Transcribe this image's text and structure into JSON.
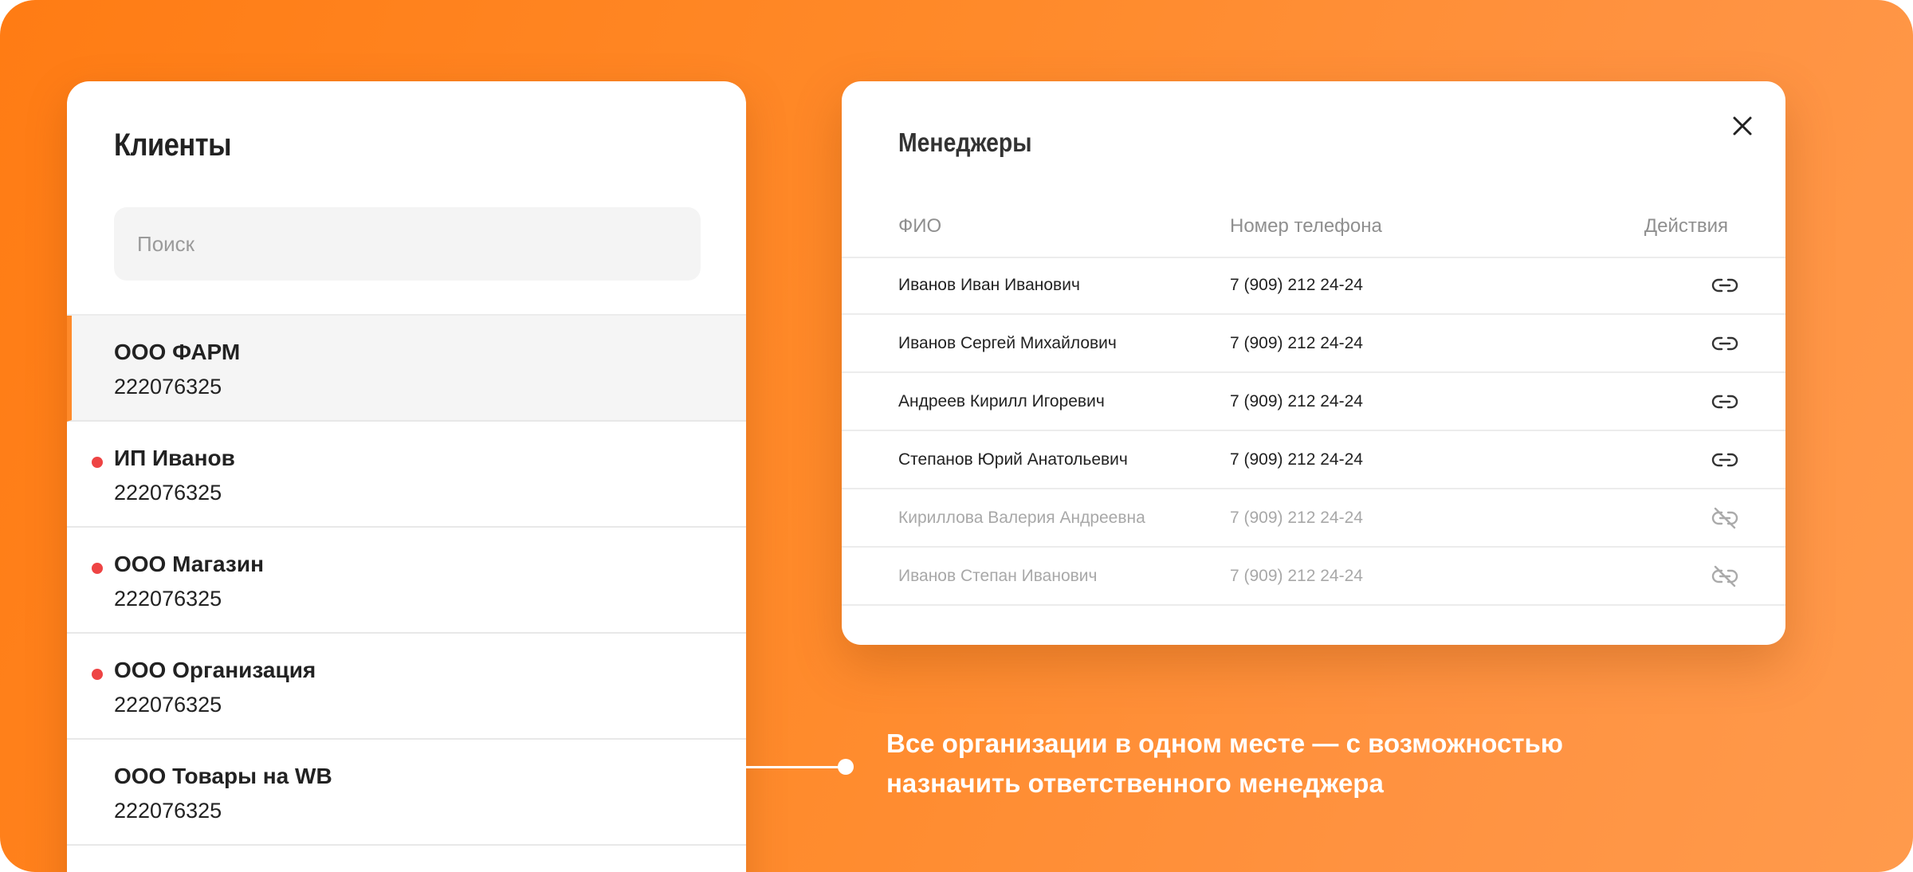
{
  "clients": {
    "title": "Клиенты",
    "search_placeholder": "Поиск",
    "items": [
      {
        "name": "ООО ФАРМ",
        "inn": "222076325",
        "active": true,
        "unread": false
      },
      {
        "name": "ИП Иванов",
        "inn": "222076325",
        "active": false,
        "unread": true
      },
      {
        "name": "ООО Магазин",
        "inn": "222076325",
        "active": false,
        "unread": true
      },
      {
        "name": "ООО Организация",
        "inn": "222076325",
        "active": false,
        "unread": true
      },
      {
        "name": "ООО Товары на WB",
        "inn": "222076325",
        "active": false,
        "unread": false
      }
    ]
  },
  "managers": {
    "title": "Менеджеры",
    "columns": {
      "fio": "ФИО",
      "phone": "Номер телефона",
      "actions": "Действия"
    },
    "rows": [
      {
        "fio": "Иванов Иван Иванович",
        "phone": "7 (909) 212 24-24",
        "action_icon": "link-icon",
        "enabled": true
      },
      {
        "fio": "Иванов Сергей Михайлович",
        "phone": "7 (909) 212 24-24",
        "action_icon": "link-icon",
        "enabled": true
      },
      {
        "fio": "Андреев Кирилл Игоревич",
        "phone": "7 (909) 212 24-24",
        "action_icon": "link-icon",
        "enabled": true
      },
      {
        "fio": "Степанов Юрий Анатольевич",
        "phone": "7 (909) 212 24-24",
        "action_icon": "link-icon",
        "enabled": true
      },
      {
        "fio": "Кириллова Валерия Андреевна",
        "phone": "7 (909) 212 24-24",
        "action_icon": "unlink-icon",
        "enabled": false
      },
      {
        "fio": "Иванов Степан Иванович",
        "phone": "7 (909) 212 24-24",
        "action_icon": "unlink-icon",
        "enabled": false
      }
    ]
  },
  "caption": {
    "line1": "Все организации в одном месте — с возможностью",
    "line2": "назначить ответственного менеджера"
  },
  "colors": {
    "accent": "#ff8a2a",
    "unread_dot": "#ee4444",
    "background_gradient_start": "#ff7c14",
    "background_gradient_end": "#ff9a4c"
  }
}
